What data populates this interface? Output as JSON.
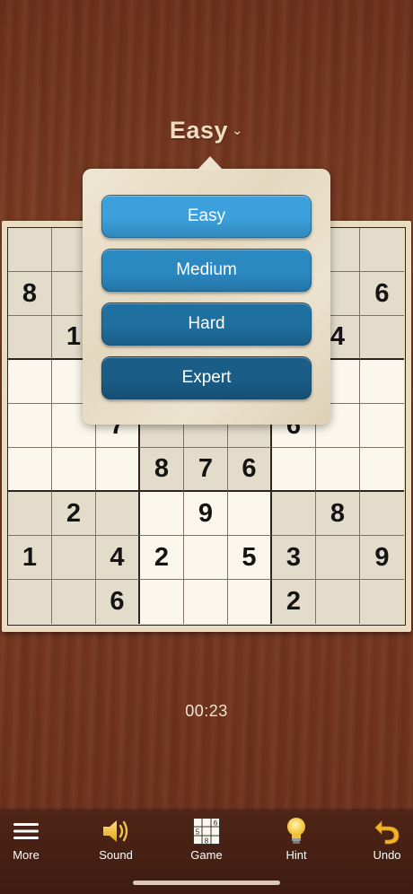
{
  "header": {
    "difficulty": "Easy",
    "chevron": "⌄"
  },
  "difficulty_menu": {
    "options": [
      {
        "label": "Easy",
        "color": "#3ba0dc"
      },
      {
        "label": "Medium",
        "color": "#2b89c2"
      },
      {
        "label": "Hard",
        "color": "#1f6fa0"
      },
      {
        "label": "Expert",
        "color": "#1a5d87"
      }
    ]
  },
  "board": {
    "rows": [
      [
        "",
        "",
        "",
        "",
        "",
        "",
        "",
        "",
        ""
      ],
      [
        "8",
        "",
        "",
        "",
        "",
        "",
        "",
        "",
        "6"
      ],
      [
        "",
        "1",
        "",
        "",
        "",
        "",
        "",
        "4",
        ""
      ],
      [
        "",
        "",
        "",
        "",
        "",
        "",
        "",
        "",
        ""
      ],
      [
        "",
        "",
        "7",
        "",
        "",
        "",
        "6",
        "",
        ""
      ],
      [
        "",
        "",
        "",
        "8",
        "7",
        "6",
        "",
        "",
        ""
      ],
      [
        "",
        "2",
        "",
        "",
        "9",
        "",
        "",
        "8",
        ""
      ],
      [
        "1",
        "",
        "4",
        "2",
        "",
        "5",
        "3",
        "",
        "9"
      ],
      [
        "",
        "",
        "6",
        "",
        "",
        "",
        "2",
        "",
        ""
      ]
    ]
  },
  "timer": "00:23",
  "toolbar": {
    "items": [
      {
        "label": "More",
        "icon": "menu-icon"
      },
      {
        "label": "Sound",
        "icon": "speaker-icon"
      },
      {
        "label": "Game",
        "icon": "sudoku-grid-icon"
      },
      {
        "label": "Hint",
        "icon": "lightbulb-icon"
      },
      {
        "label": "Undo",
        "icon": "undo-arrow-icon"
      }
    ],
    "game_icon_digits": [
      "6",
      "5",
      "8"
    ]
  }
}
